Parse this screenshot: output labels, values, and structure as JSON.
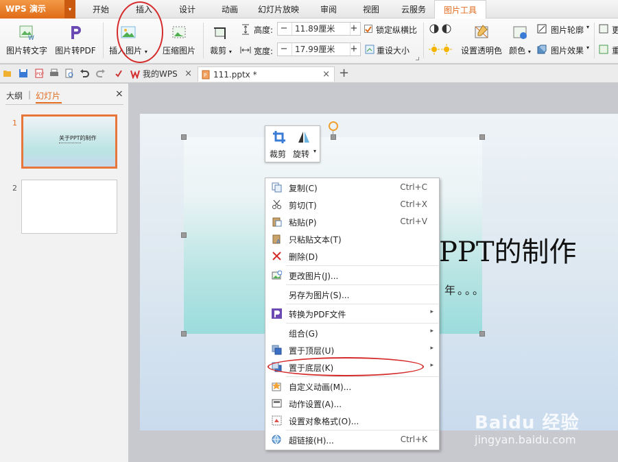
{
  "app": {
    "title": "WPS 演示",
    "menu_arrow": "▾"
  },
  "menu": {
    "tabs": [
      {
        "label": "开始"
      },
      {
        "label": "插入"
      },
      {
        "label": "设计"
      },
      {
        "label": "动画"
      },
      {
        "label": "幻灯片放映"
      },
      {
        "label": "审阅"
      },
      {
        "label": "视图"
      },
      {
        "label": "云服务"
      },
      {
        "label": "图片工具"
      }
    ]
  },
  "ribbon": {
    "pic_to_text": "图片转文字",
    "pic_to_pdf": "图片转PDF",
    "insert_pic": "插入图片",
    "dropdown": "▾",
    "compress": "压缩图片",
    "crop": "裁剪",
    "height_label": "高度:",
    "height_value": "11.89厘米",
    "width_label": "宽度:",
    "width_value": "17.99厘米",
    "minus": "−",
    "plus": "+",
    "lock_ratio": "锁定纵横比",
    "reset_size": "重设大小",
    "set_transparent": "设置透明色",
    "color": "颜色",
    "outline": "图片轮廓",
    "effect": "图片效果",
    "more1": "更",
    "more2": "重"
  },
  "quickbar": {
    "tab_wps": "我的WPS",
    "tab_file": "111.pptx *",
    "close": "×",
    "new_tab": "+"
  },
  "leftpanel": {
    "tab_outline": "大纲",
    "tab_slides": "幻灯片",
    "separator": "|",
    "close": "×",
    "thumb1_num": "1",
    "thumb1_title": "关于PPT的制作",
    "thumb2_num": "2"
  },
  "slide": {
    "title": "PPT的制作",
    "subtitle": "年。。。"
  },
  "minitool": {
    "crop": "裁剪",
    "rotate": "旋转"
  },
  "context_menu": {
    "items": [
      {
        "label": "复制(C)",
        "shortcut": "Ctrl+C"
      },
      {
        "label": "剪切(T)",
        "shortcut": "Ctrl+X"
      },
      {
        "label": "粘贴(P)",
        "shortcut": "Ctrl+V"
      },
      {
        "label": "只粘贴文本(T)",
        "shortcut": ""
      },
      {
        "label": "删除(D)",
        "shortcut": ""
      },
      {
        "label": "更改图片(J)...",
        "shortcut": ""
      },
      {
        "label": "另存为图片(S)...",
        "shortcut": ""
      },
      {
        "label": "转换为PDF文件",
        "shortcut": ""
      },
      {
        "label": "组合(G)",
        "shortcut": ""
      },
      {
        "label": "置于顶层(U)",
        "shortcut": ""
      },
      {
        "label": "置于底层(K)",
        "shortcut": ""
      },
      {
        "label": "自定义动画(M)...",
        "shortcut": ""
      },
      {
        "label": "动作设置(A)...",
        "shortcut": ""
      },
      {
        "label": "设置对象格式(O)...",
        "shortcut": ""
      },
      {
        "label": "超链接(H)...",
        "shortcut": "Ctrl+K"
      }
    ],
    "submenu_arrow": "▸"
  },
  "watermark": {
    "logo": "Baidu 经验",
    "url": "jingyan.baidu.com"
  },
  "colors": {
    "accent": "#e26a1d",
    "annotation": "#d62b2b",
    "app_orange": "#e06b17"
  }
}
